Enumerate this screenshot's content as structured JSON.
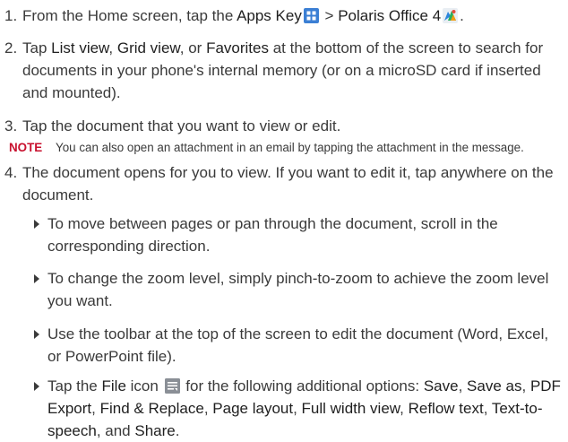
{
  "steps": [
    {
      "num": "1.",
      "t1": "From the Home screen, tap the ",
      "apps_key": "Apps Key",
      "t2": " > ",
      "polaris": "Polaris Office 4",
      "t3": ".",
      "icons": [
        "apps-grid-icon",
        "polaris-office-icon"
      ]
    },
    {
      "num": "2.",
      "t1": "Tap ",
      "list_view": "List view",
      "t2": ", ",
      "grid_view": "Grid view",
      "t3": ", or ",
      "favorites": "Favorites",
      "t4": " at the bottom of the screen to search for documents in your phone's internal memory (or on a microSD card if inserted and mounted)."
    },
    {
      "num": "3.",
      "text": "Tap the document that you want to view or edit."
    },
    {
      "num": "4.",
      "text": "The document opens for you to view. If you want to edit it, tap anywhere on the document."
    }
  ],
  "note": {
    "label": "NOTE",
    "text": "You can also open an attachment in an email by tapping the attachment in the message."
  },
  "bullets": {
    "b1": "To move between pages or pan through the document, scroll in the corresponding direction.",
    "b2": "To change the zoom level, simply pinch-to-zoom to achieve the zoom level you want.",
    "b3": "Use the toolbar at the top of the screen to edit the document (Word, Excel, or PowerPoint file).",
    "b4": {
      "t1": "Tap the ",
      "file": "File",
      "t2": " icon ",
      "t3": " for the following additional options: ",
      "save": "Save",
      "sep1": ", ",
      "save_as": "Save as",
      "sep2": ", ",
      "pdf_export": "PDF Export",
      "sep3": ", ",
      "find_replace": "Find & Replace",
      "sep4": ", ",
      "page_layout": "Page layout",
      "sep5": ", ",
      "full_width": "Full width view",
      "sep6": ", ",
      "reflow": "Reflow text",
      "sep7": ", ",
      "tts": "Text-to-speech",
      "sep8": ", and ",
      "share": "Share",
      "end": ".",
      "icon": "file-menu-icon"
    }
  },
  "colors": {
    "text": "#3a3a3a",
    "note_label": "#c8102e",
    "apps_icon": "#3b7fd4"
  }
}
